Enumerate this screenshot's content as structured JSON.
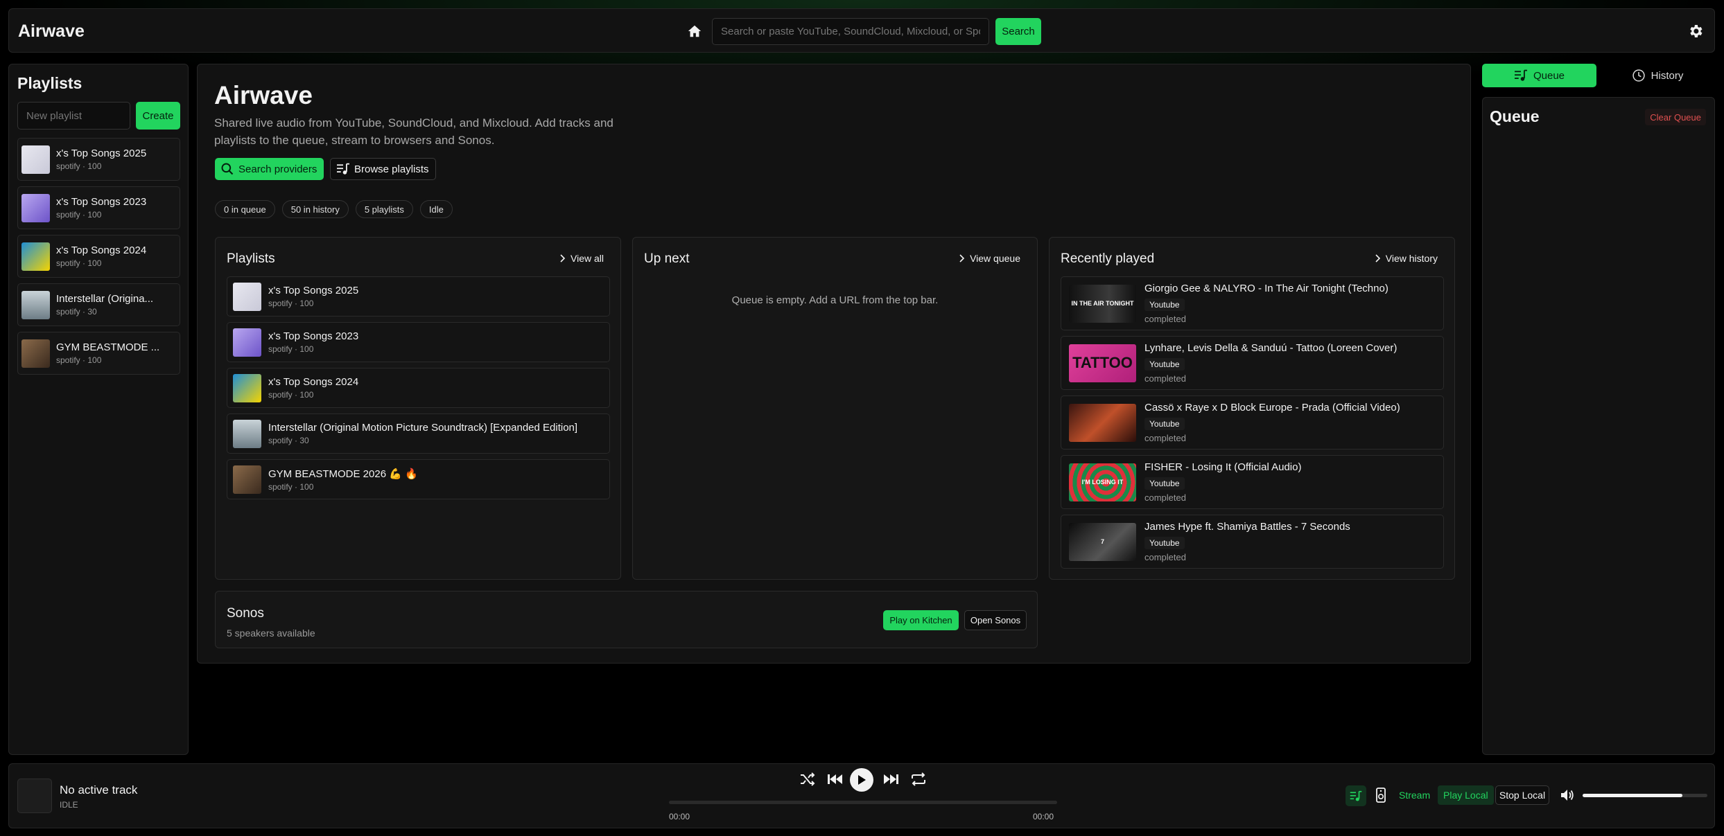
{
  "app": {
    "title": "Airwave"
  },
  "topbar": {
    "search_placeholder": "Search or paste YouTube, SoundCloud, Mixcloud, or Spotify URL",
    "search_button": "Search"
  },
  "sidebar": {
    "title": "Playlists",
    "new_placeholder": "New playlist",
    "create_label": "Create",
    "items": [
      {
        "name": "x's Top Songs 2025",
        "meta": "spotify · 100"
      },
      {
        "name": "x's Top Songs 2023",
        "meta": "spotify · 100"
      },
      {
        "name": "x's Top Songs 2024",
        "meta": "spotify · 100"
      },
      {
        "name": "Interstellar (Origina...",
        "meta": "spotify · 30"
      },
      {
        "name": "GYM BEASTMODE ...",
        "meta": "spotify · 100"
      }
    ]
  },
  "main": {
    "title": "Airwave",
    "subtitle_line1": "Shared live audio from YouTube, SoundCloud, and Mixcloud. Add tracks and",
    "subtitle_line2": "playlists to the queue, stream to browsers and Sonos.",
    "search_providers": "Search providers",
    "browse_playlists": "Browse playlists",
    "stats": [
      "0 in queue",
      "50 in history",
      "5 playlists",
      "Idle"
    ]
  },
  "playlists_card": {
    "title": "Playlists",
    "view_all": "View all",
    "items": [
      {
        "name": "x's Top Songs 2025",
        "meta": "spotify · 100"
      },
      {
        "name": "x's Top Songs 2023",
        "meta": "spotify · 100"
      },
      {
        "name": "x's Top Songs 2024",
        "meta": "spotify · 100"
      },
      {
        "name": "Interstellar (Original Motion Picture Soundtrack) [Expanded Edition]",
        "meta": "spotify · 30"
      },
      {
        "name": "GYM BEASTMODE 2026 💪 🔥",
        "meta": "spotify · 100"
      }
    ]
  },
  "upnext_card": {
    "title": "Up next",
    "view_queue": "View queue",
    "empty": "Queue is empty. Add a URL from the top bar."
  },
  "recent_card": {
    "title": "Recently played",
    "view_history": "View history",
    "items": [
      {
        "title": "Giorgio Gee & NALYRO - In The Air Tonight (Techno)",
        "source": "Youtube",
        "status": "completed",
        "thumb_text": "IN THE AIR TONIGHT"
      },
      {
        "title": "Lynhare, Levis Della & Sanduú - Tattoo (Loreen Cover)",
        "source": "Youtube",
        "status": "completed",
        "thumb_text": "TATTOO"
      },
      {
        "title": "Cassö x Raye x D Block Europe - Prada (Official Video)",
        "source": "Youtube",
        "status": "completed",
        "thumb_text": ""
      },
      {
        "title": "FISHER - Losing It (Official Audio)",
        "source": "Youtube",
        "status": "completed",
        "thumb_text": "I'M LOSING IT"
      },
      {
        "title": "James Hype ft. Shamiya Battles - 7 Seconds",
        "source": "Youtube",
        "status": "completed",
        "thumb_text": "7"
      }
    ]
  },
  "sonos": {
    "title": "Sonos",
    "subtitle": "5 speakers available",
    "play_on": "Play on Kitchen",
    "open": "Open Sonos"
  },
  "right_panel": {
    "tab_queue": "Queue",
    "tab_history": "History",
    "title": "Queue",
    "clear": "Clear Queue"
  },
  "player": {
    "track": "No active track",
    "state": "IDLE",
    "time_current": "00:00",
    "time_total": "00:00",
    "stream": "Stream",
    "play_local": "Play Local",
    "stop_local": "Stop Local",
    "volume": 0.8
  },
  "colors": {
    "accent": "#22d45e",
    "danger": "#e05050",
    "panel": "#121212"
  }
}
